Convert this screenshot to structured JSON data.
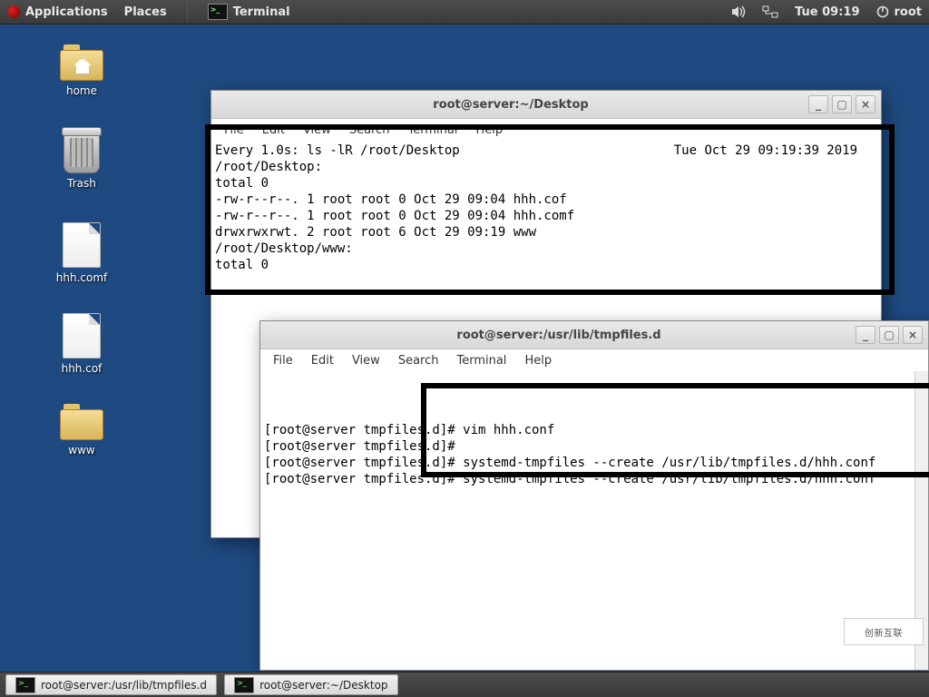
{
  "panel": {
    "applications": "Applications",
    "places": "Places",
    "app_label": "Terminal",
    "clock": "Tue 09:19",
    "user": "root"
  },
  "desktop_icons": {
    "home": "home",
    "trash": "Trash",
    "file1": "hhh.comf",
    "file2": "hhh.cof",
    "folder": "www"
  },
  "window_back": {
    "title": "root@server:~/Desktop",
    "menu": {
      "file": "File",
      "edit": "Edit",
      "view": "View",
      "search": "Search",
      "terminal": "Terminal",
      "help": "Help"
    },
    "lines": [
      "Every 1.0s: ls -lR /root/Desktop                            Tue Oct 29 09:19:39 2019",
      "",
      "/root/Desktop:",
      "total 0",
      "-rw-r--r--. 1 root root 0 Oct 29 09:04 hhh.cof",
      "-rw-r--r--. 1 root root 0 Oct 29 09:04 hhh.comf",
      "drwxrwxrwt. 2 root root 6 Oct 29 09:19 www",
      "",
      "/root/Desktop/www:",
      "total 0"
    ]
  },
  "window_front": {
    "title": "root@server:/usr/lib/tmpfiles.d",
    "menu": {
      "file": "File",
      "edit": "Edit",
      "view": "View",
      "search": "Search",
      "terminal": "Terminal",
      "help": "Help"
    },
    "lines": [
      "[root@server tmpfiles.d]# vim hhh.conf",
      "[root@server tmpfiles.d]# ",
      "[root@server tmpfiles.d]# systemd-tmpfiles --create /usr/lib/tmpfiles.d/hhh.conf",
      "[root@server tmpfiles.d]# systemd-tmpfiles --create /usr/lib/tmpfiles.d/hhh.conf"
    ]
  },
  "taskbar": {
    "btn1": "root@server:/usr/lib/tmpfiles.d",
    "btn2": "root@server:~/Desktop"
  },
  "watermark": "创新互联"
}
